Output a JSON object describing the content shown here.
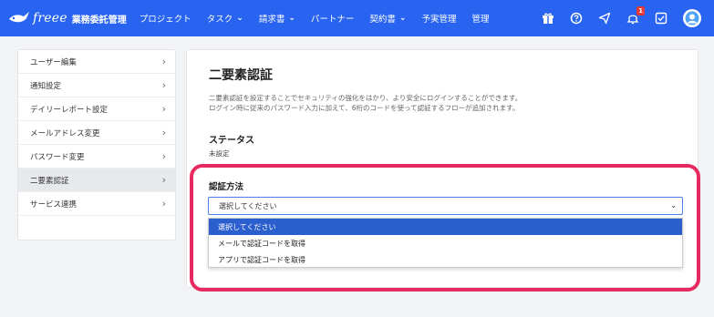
{
  "header": {
    "brand": "freee",
    "product": "業務委託管理",
    "nav": [
      {
        "label": "プロジェクト",
        "caret": false
      },
      {
        "label": "タスク",
        "caret": true
      },
      {
        "label": "請求書",
        "caret": true
      },
      {
        "label": "パートナー",
        "caret": false
      },
      {
        "label": "契約書",
        "caret": true
      },
      {
        "label": "予実管理",
        "caret": false
      },
      {
        "label": "管理",
        "caret": false
      }
    ],
    "notification_count": "1",
    "icons": [
      "gift-icon",
      "help-icon",
      "send-icon",
      "bell-icon",
      "checkbox-icon",
      "avatar"
    ]
  },
  "sidebar": {
    "items": [
      {
        "label": "ユーザー編集"
      },
      {
        "label": "通知設定"
      },
      {
        "label": "デイリーレポート設定"
      },
      {
        "label": "メールアドレス変更"
      },
      {
        "label": "パスワード変更"
      },
      {
        "label": "二要素認証"
      },
      {
        "label": "サービス連携"
      }
    ],
    "active_index": 5
  },
  "main": {
    "title": "二要素認証",
    "description_1": "二要素認証を設定することでセキュリティの強化をはかり、より安全にログインすることができます。",
    "description_2": "ログイン時に従来のパスワード入力に加えて、6桁のコードを使って認証するフローが追加されます。",
    "status_heading": "ステータス",
    "status_value": "未設定",
    "method_heading": "認証方法",
    "select_value": "選択してください",
    "options": [
      "選択してください",
      "メールで認証コードを取得",
      "アプリで認証コードを取得"
    ],
    "selected_option_index": 0
  },
  "colors": {
    "header_bg": "#2864f0",
    "highlight": "#e6295f",
    "option_selected": "#2b5fce"
  }
}
